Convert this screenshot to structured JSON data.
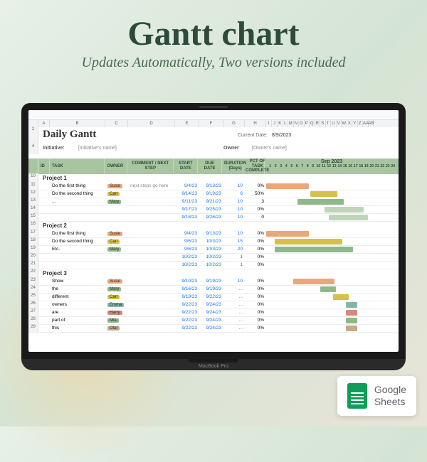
{
  "header": {
    "title": "Gantt chart",
    "subtitle": "Updates Automatically, Two versions included"
  },
  "badge": {
    "brand": "Google",
    "product": "Sheets"
  },
  "laptop_label": "MacBook Pro",
  "sheet": {
    "title": "Daily Gantt",
    "current_date_label": "Current Date:",
    "current_date": "8/9/2023",
    "initiative_label": "Initiative:",
    "initiative_value": "[Initiative's name]",
    "owner_label": "Owner",
    "owner_value": "[Owner's name]",
    "columns": [
      "ID",
      "TASK",
      "OWNER",
      "COMMENT / NEXT STEP",
      "START DATE",
      "DUE DATE",
      "DURATION (Days)",
      "PCT OF TASK COMPLETE"
    ],
    "month": "Sep 2023",
    "days": [
      "1",
      "2",
      "3",
      "4",
      "5",
      "6",
      "7",
      "8",
      "9",
      "10",
      "11",
      "12",
      "13",
      "14",
      "15",
      "16",
      "17",
      "18",
      "19",
      "20",
      "21",
      "22",
      "23",
      "24"
    ],
    "col_letters": [
      "A",
      "B",
      "C",
      "D",
      "E",
      "F",
      "G",
      "H",
      "I",
      "J",
      "K",
      "L",
      "M",
      "N",
      "O",
      "P",
      "Q",
      "R",
      "S",
      "T",
      "U",
      "V",
      "W",
      "X",
      "Y",
      "Z",
      "AA",
      "AB"
    ],
    "projects": [
      {
        "name": "Project 1",
        "rows": [
          {
            "task": "Do the first thing",
            "owner": "Susie",
            "owner_color": "#e8a87c",
            "comment": "next steps go here",
            "start": "9/4/23",
            "due": "9/13/23",
            "dur": "10",
            "pct": "0%",
            "gl": 0,
            "gw": 60,
            "gc": "#e8a87c"
          },
          {
            "task": "Do the second thing",
            "owner": "Carl",
            "owner_color": "#d4c04a",
            "comment": "",
            "start": "9/14/23",
            "due": "9/19/23",
            "dur": "6",
            "pct": "50%",
            "gl": 62,
            "gw": 38,
            "gc": "#d4c04a"
          },
          {
            "task": "...",
            "owner": "Mary",
            "owner_color": "#8fb88a",
            "comment": "",
            "start": "9/11/23",
            "due": "9/21/23",
            "dur": "10",
            "pct": "3",
            "gl": 44,
            "gw": 65,
            "gc": "#8fb88a"
          },
          {
            "task": "",
            "owner": "",
            "owner_color": "",
            "comment": "",
            "start": "9/17/23",
            "due": "9/25/23",
            "dur": "10",
            "pct": "0%",
            "gl": 82,
            "gw": 55,
            "gc": "#c0d4b8"
          },
          {
            "task": "",
            "owner": "",
            "owner_color": "",
            "comment": "",
            "start": "9/18/23",
            "due": "9/26/23",
            "dur": "10",
            "pct": "0",
            "gl": 88,
            "gw": 55,
            "gc": "#c0d4b8"
          }
        ]
      },
      {
        "name": "Project 2",
        "rows": [
          {
            "task": "Do the first thing",
            "owner": "Susie",
            "owner_color": "#e8a87c",
            "comment": "",
            "start": "9/4/23",
            "due": "9/13/23",
            "dur": "10",
            "pct": "0%",
            "gl": 0,
            "gw": 60,
            "gc": "#e8a87c"
          },
          {
            "task": "Do the second thing",
            "owner": "Carl",
            "owner_color": "#d4c04a",
            "comment": "",
            "start": "9/6/23",
            "due": "10/3/23",
            "dur": "15",
            "pct": "0%",
            "gl": 12,
            "gw": 95,
            "gc": "#d4c04a"
          },
          {
            "task": "Etc.",
            "owner": "Mary",
            "owner_color": "#8fb88a",
            "comment": "",
            "start": "9/6/23",
            "due": "10/3/23",
            "dur": "20",
            "pct": "0%",
            "gl": 12,
            "gw": 110,
            "gc": "#8fb88a"
          },
          {
            "task": "",
            "owner": "",
            "owner_color": "",
            "comment": "",
            "start": "10/2/23",
            "due": "10/2/23",
            "dur": "1",
            "pct": "0%",
            "gl": 0,
            "gw": 0,
            "gc": ""
          },
          {
            "task": "",
            "owner": "",
            "owner_color": "",
            "comment": "",
            "start": "10/2/23",
            "due": "10/2/23",
            "dur": "1",
            "pct": "0%",
            "gl": 0,
            "gw": 0,
            "gc": ""
          }
        ]
      },
      {
        "name": "Project 3",
        "rows": [
          {
            "task": "Show",
            "owner": "Susie",
            "owner_color": "#e8a87c",
            "comment": "",
            "start": "9/10/23",
            "due": "9/19/23",
            "dur": "10",
            "pct": "0%",
            "gl": 38,
            "gw": 58,
            "gc": "#e8a87c"
          },
          {
            "task": "the",
            "owner": "Mary",
            "owner_color": "#8fb88a",
            "comment": "",
            "start": "9/16/23",
            "due": "9/19/23",
            "dur": "...",
            "pct": "0%",
            "gl": 76,
            "gw": 22,
            "gc": "#8fb88a"
          },
          {
            "task": "different",
            "owner": "Carl",
            "owner_color": "#d4c04a",
            "comment": "",
            "start": "9/19/23",
            "due": "9/22/23",
            "dur": "...",
            "pct": "0%",
            "gl": 94,
            "gw": 22,
            "gc": "#d4c04a"
          },
          {
            "task": "owners",
            "owner": "Emma",
            "owner_color": "#7fb8a8",
            "comment": "",
            "start": "9/22/23",
            "due": "9/24/23",
            "dur": "...",
            "pct": "0%",
            "gl": 112,
            "gw": 16,
            "gc": "#7fb8a8"
          },
          {
            "task": "are",
            "owner": "Harry",
            "owner_color": "#d48a7c",
            "comment": "",
            "start": "9/22/23",
            "due": "9/24/23",
            "dur": "...",
            "pct": "0%",
            "gl": 112,
            "gw": 16,
            "gc": "#d48a7c"
          },
          {
            "task": "part of",
            "owner": "Mia",
            "owner_color": "#8fb88a",
            "comment": "",
            "start": "9/22/23",
            "due": "9/24/23",
            "dur": "...",
            "pct": "0%",
            "gl": 112,
            "gw": 16,
            "gc": "#8fb88a"
          },
          {
            "task": "this",
            "owner": "Olaf",
            "owner_color": "#c4a888",
            "comment": "",
            "start": "9/22/23",
            "due": "9/24/23",
            "dur": "...",
            "pct": "0%",
            "gl": 112,
            "gw": 16,
            "gc": "#c4a888"
          }
        ]
      }
    ]
  }
}
